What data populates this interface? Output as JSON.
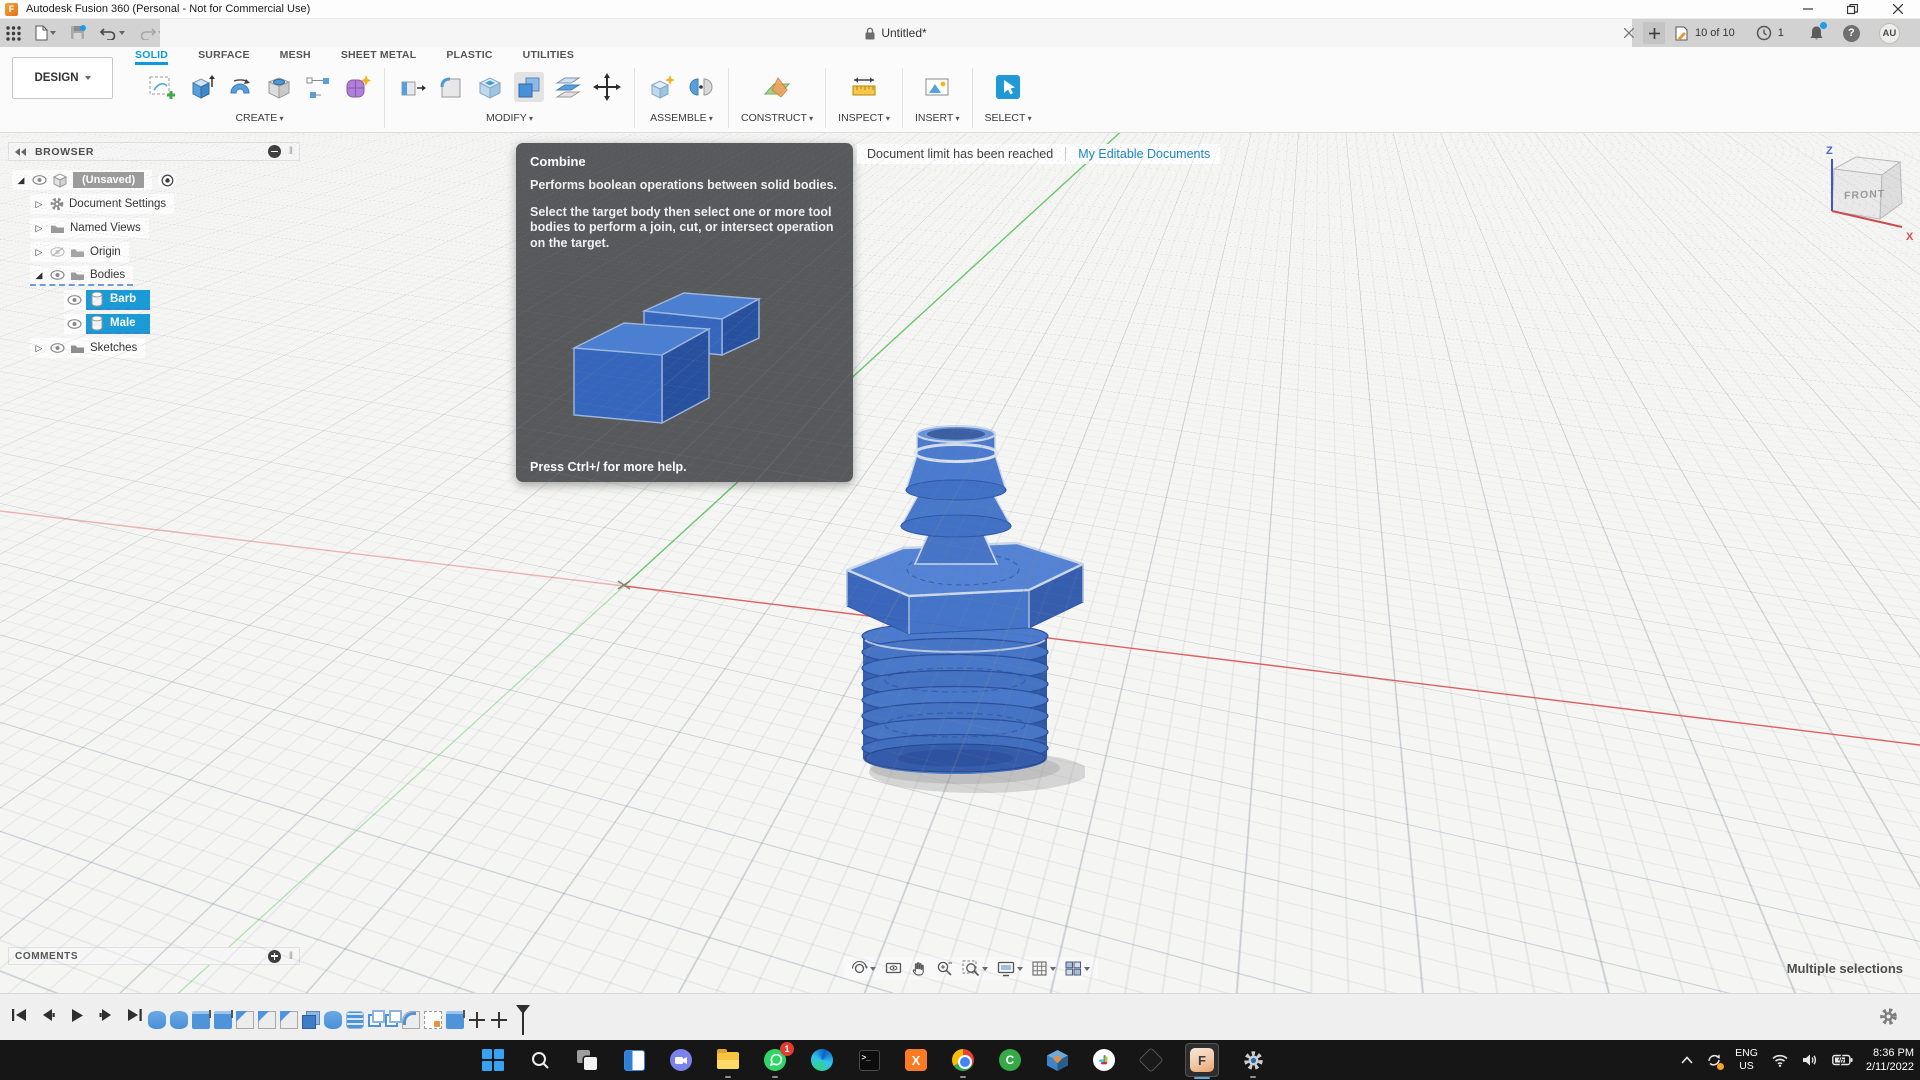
{
  "window": {
    "title": "Autodesk Fusion 360 (Personal - Not for Commercial Use)"
  },
  "tabbar": {
    "doc_title": "Untitled*",
    "docs_count": "10 of 10",
    "notifications": "1",
    "avatar": "AU"
  },
  "ribbon": {
    "design": "DESIGN",
    "tabs": [
      "SOLID",
      "SURFACE",
      "MESH",
      "SHEET METAL",
      "PLASTIC",
      "UTILITIES"
    ],
    "groups": [
      "CREATE",
      "MODIFY",
      "ASSEMBLE",
      "CONSTRUCT",
      "INSPECT",
      "INSERT",
      "SELECT"
    ]
  },
  "banner": {
    "message": "Document limit has been reached",
    "link": "My Editable Documents"
  },
  "tooltip": {
    "title": "Combine",
    "description": "Performs boolean operations between solid bodies.",
    "details": "Select the target body then select one or more tool bodies to perform a join, cut, or intersect operation on the target.",
    "footer": "Press Ctrl+/ for more help."
  },
  "browser": {
    "header": "BROWSER",
    "items": [
      {
        "label": "(Unsaved)"
      },
      {
        "label": "Document Settings"
      },
      {
        "label": "Named Views"
      },
      {
        "label": "Origin"
      },
      {
        "label": "Bodies"
      },
      {
        "label": "Barb"
      },
      {
        "label": "Male"
      },
      {
        "label": "Sketches"
      }
    ]
  },
  "comments": {
    "header": "COMMENTS"
  },
  "viewport": {
    "status": "Multiple selections",
    "viewcube_face": "FRONT",
    "axis_z": "Z",
    "axis_x": "X"
  },
  "taskbar": {
    "whatsapp_badge": "1"
  },
  "tray": {
    "language": "ENG",
    "region": "US",
    "time": "8:36 PM",
    "date": "2/11/2022"
  },
  "colors": {
    "accent": "#0a9bda",
    "selection": "#189bd7",
    "model_blue": "#3a6ec5",
    "axis_x": "#de5f5f",
    "axis_y": "#69c869"
  }
}
